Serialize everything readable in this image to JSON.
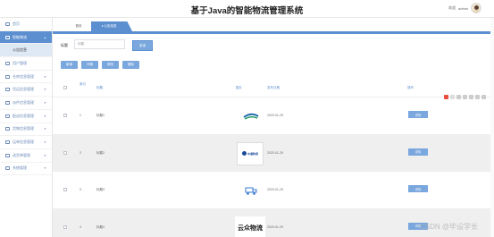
{
  "header": {
    "title": "基于Java的智能物流管理系统",
    "welcome": "欢迎",
    "username": "admin"
  },
  "sidebar": {
    "items": [
      {
        "label": "首页"
      },
      {
        "label": "智能物流"
      },
      {
        "label": "公告信息"
      },
      {
        "label": "用户管理"
      },
      {
        "label": "仓库信息管理"
      },
      {
        "label": "货运信息管理"
      },
      {
        "label": "派件信息管理"
      },
      {
        "label": "配送信息管理"
      },
      {
        "label": "货物信息管理"
      },
      {
        "label": "运单信息管理"
      },
      {
        "label": "送货单管理"
      },
      {
        "label": "系统管理"
      }
    ]
  },
  "tabs": {
    "home": "首页",
    "active": "● 公告信息"
  },
  "search": {
    "label": "标题",
    "placeholder": "标题",
    "button": "查询"
  },
  "actions": {
    "add": "新增",
    "detail": "详情",
    "edit": "修改",
    "delete": "删除"
  },
  "table": {
    "headers": {
      "index": "索引",
      "title": "标题",
      "image": "图片",
      "date": "发布日期",
      "op": "操作"
    },
    "rows": [
      {
        "index": "1",
        "title": "标题1",
        "date": "2020-01-29",
        "button": "详情",
        "logo": "logo-a"
      },
      {
        "index": "2",
        "title": "标题2",
        "date": "2020-01-29",
        "button": "详情",
        "logo": "logo-b"
      },
      {
        "index": "3",
        "title": "标题3",
        "date": "2020-01-29",
        "button": "详情",
        "logo": "logo-c"
      },
      {
        "index": "4",
        "title": "标题4",
        "date": "2020-01-29",
        "button": "详情",
        "logo": "logo-d"
      }
    ]
  },
  "logos": {
    "b_text": "中通物流",
    "d_text": "云众物流"
  },
  "watermark": "CSDN @毕设学长",
  "colors": {
    "accent": "#5b8fd0",
    "button": "#7aa7dd"
  }
}
